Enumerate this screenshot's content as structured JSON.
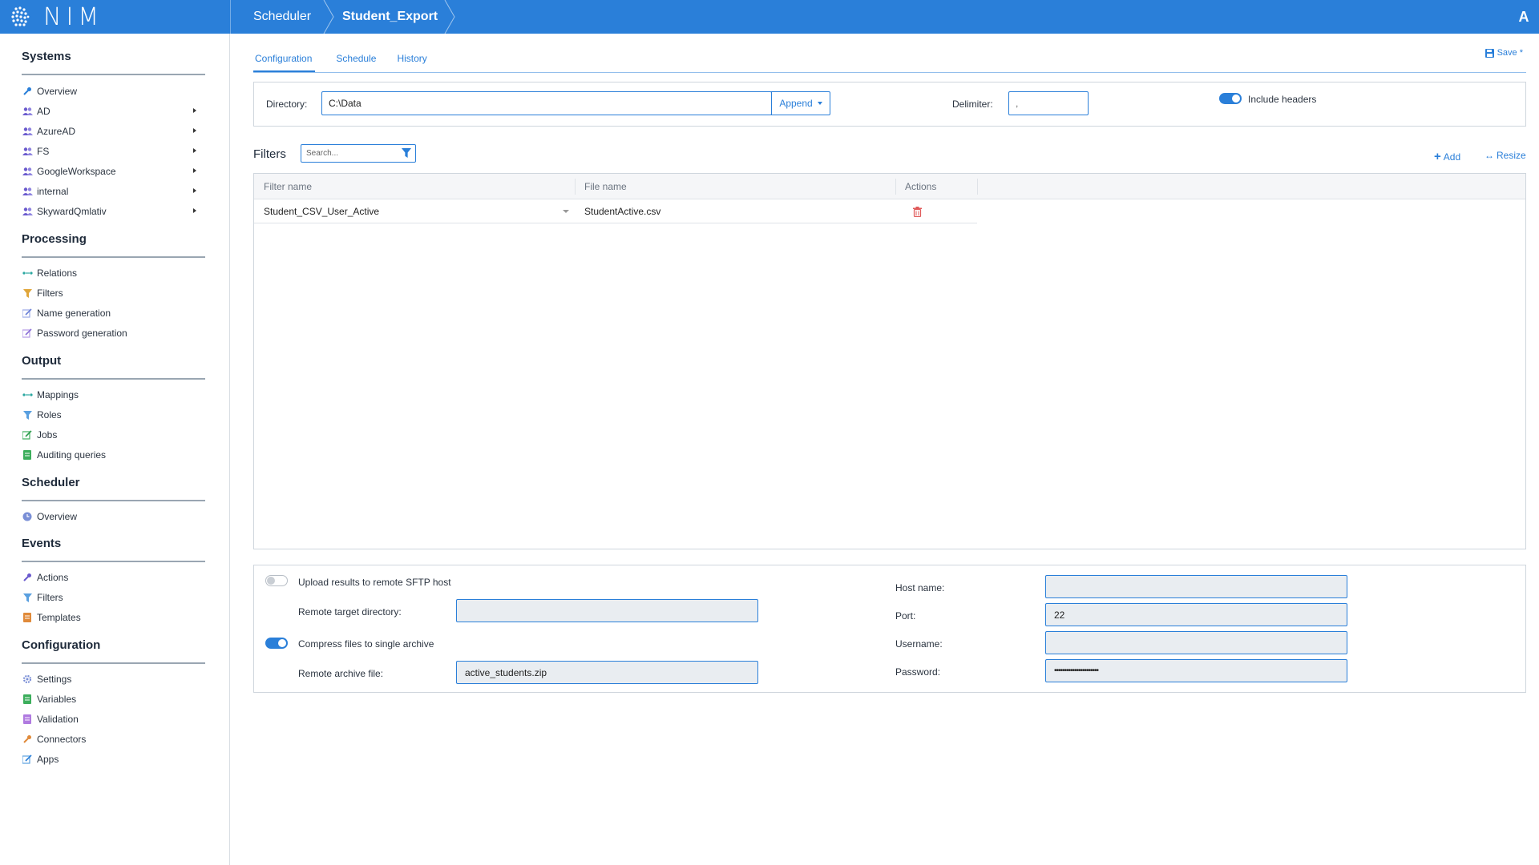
{
  "app": {
    "logo_text": "NIM",
    "user_initial": "A"
  },
  "breadcrumb": {
    "parent": "Scheduler",
    "current": "Student_Export"
  },
  "sidebar": {
    "systems": {
      "title": "Systems",
      "items": [
        "Overview",
        "AD",
        "AzureAD",
        "FS",
        "GoogleWorkspace",
        "internal",
        "SkywardQmlativ"
      ]
    },
    "processing": {
      "title": "Processing",
      "items": [
        "Relations",
        "Filters",
        "Name generation",
        "Password generation"
      ]
    },
    "output": {
      "title": "Output",
      "items": [
        "Mappings",
        "Roles",
        "Jobs",
        "Auditing queries"
      ]
    },
    "scheduler": {
      "title": "Scheduler",
      "items": [
        "Overview"
      ]
    },
    "events": {
      "title": "Events",
      "items": [
        "Actions",
        "Filters",
        "Templates"
      ]
    },
    "configuration": {
      "title": "Configuration",
      "items": [
        "Settings",
        "Variables",
        "Validation",
        "Connectors",
        "Apps"
      ]
    }
  },
  "tabs": [
    "Configuration",
    "Schedule",
    "History"
  ],
  "toolbar": {
    "save_label": "Save *"
  },
  "config": {
    "directory_label": "Directory:",
    "directory_value": "C:\\Data",
    "append_label": "Append",
    "delimiter_label": "Delimiter:",
    "delimiter_value": ",",
    "include_headers_label": "Include headers",
    "include_headers_on": true
  },
  "filters": {
    "title": "Filters",
    "search_placeholder": "Search...",
    "add_label": "Add",
    "resize_label": "Resize",
    "columns": [
      "Filter name",
      "File name",
      "Actions"
    ],
    "rows": [
      {
        "filter_name": "Student_CSV_User_Active",
        "file_name": "StudentActive.csv"
      }
    ]
  },
  "sftp": {
    "upload_label": "Upload results to remote SFTP host",
    "upload_on": false,
    "remote_dir_label": "Remote target directory:",
    "remote_dir_value": "",
    "compress_label": "Compress files to single archive",
    "compress_on": true,
    "archive_label": "Remote archive file:",
    "archive_value": "active_students.zip",
    "host_label": "Host name:",
    "host_value": "",
    "port_label": "Port:",
    "port_value": "22",
    "username_label": "Username:",
    "username_value": "",
    "password_label": "Password:",
    "password_value": "••••••••••••••••••••••"
  },
  "colors": {
    "accent": "#2a7fd9",
    "delete": "#e05a5a"
  }
}
